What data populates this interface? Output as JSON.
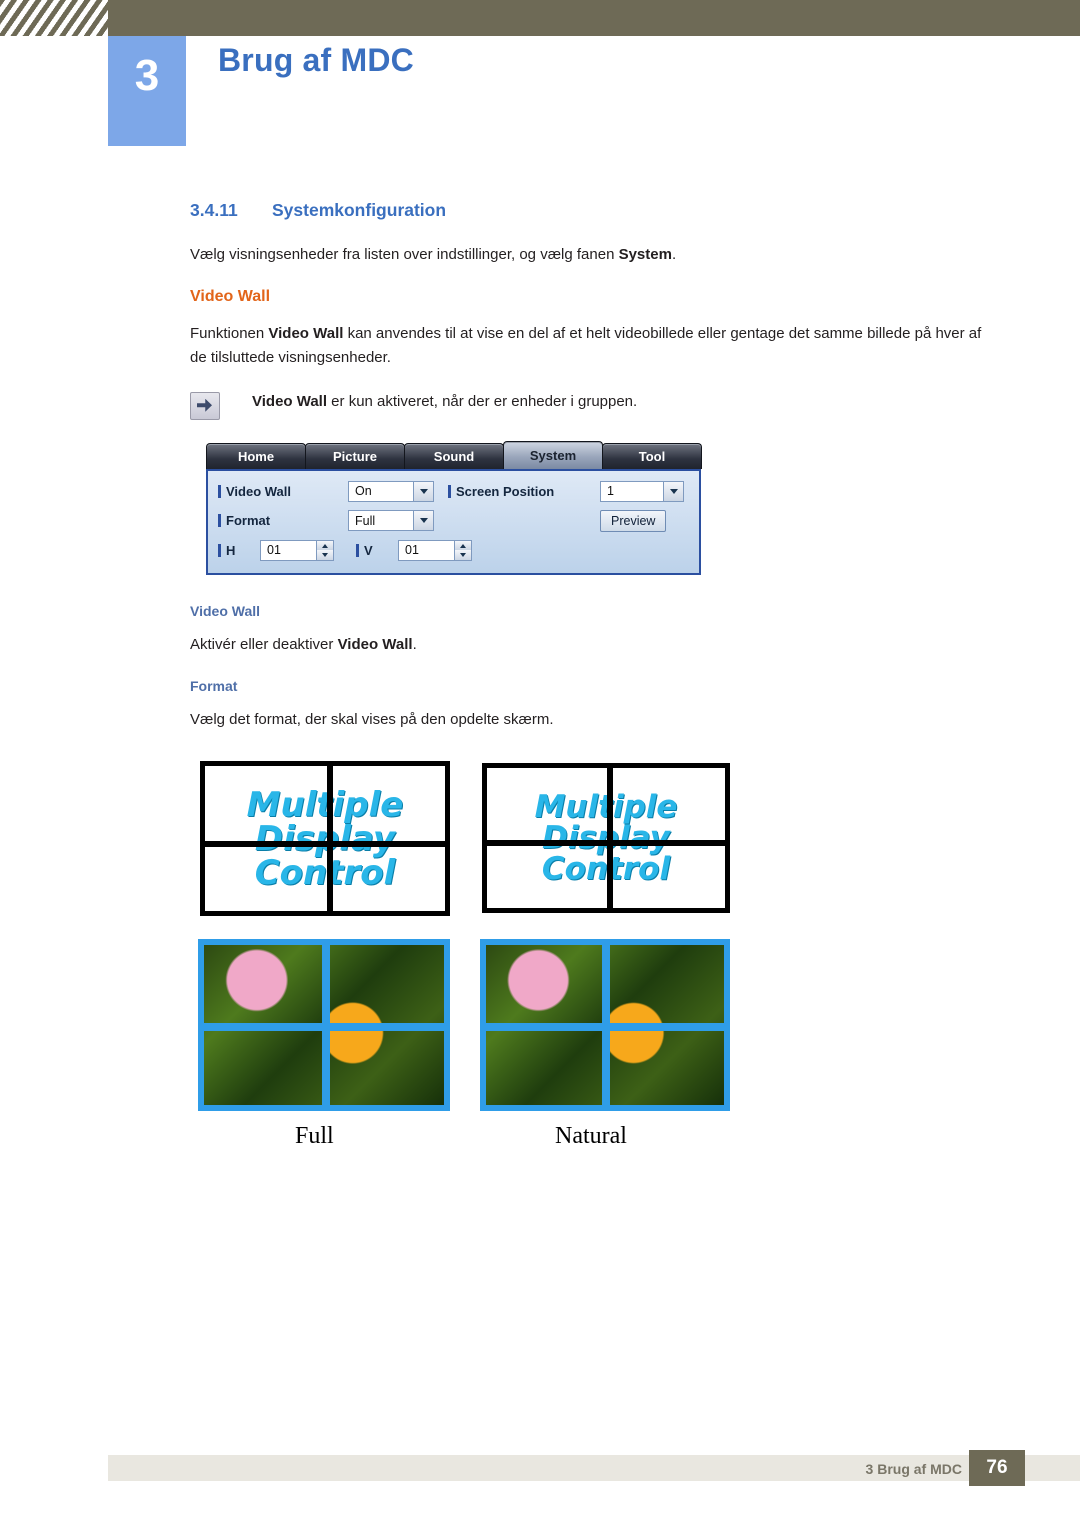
{
  "header": {
    "chapter_number": "3",
    "chapter_title": "Brug af MDC"
  },
  "section": {
    "number": "3.4.11",
    "title": "Systemkonfiguration",
    "intro_prefix": "Vælg visningsenheder fra listen over indstillinger, og vælg fanen ",
    "intro_bold": "System",
    "intro_suffix": "."
  },
  "video_wall": {
    "heading": "Video Wall",
    "para_1_prefix": "Funktionen ",
    "para_1_bold": "Video Wall",
    "para_1_suffix": " kan anvendes til at vise en del af et helt videobillede eller gentage det samme billede på hver af de tilsluttede visningsenheder.",
    "note_bold": "Video Wall",
    "note_rest": " er kun aktiveret, når der er enheder i gruppen.",
    "note_icon": "note-pointer-icon",
    "sub_heading": "Video Wall",
    "sub_text_prefix": "Aktivér eller deaktiver ",
    "sub_text_bold": "Video Wall",
    "sub_text_suffix": "."
  },
  "format": {
    "heading": "Format",
    "text": "Vælg det format, der skal vises på den opdelte skærm.",
    "label_full": "Full",
    "label_natural": "Natural",
    "wall_text_line1": "Multiple",
    "wall_text_line2": "Display",
    "wall_text_line3": "Control"
  },
  "mdc_ui": {
    "tabs": [
      {
        "label": "Home",
        "active": false
      },
      {
        "label": "Picture",
        "active": false
      },
      {
        "label": "Sound",
        "active": false
      },
      {
        "label": "System",
        "active": true
      },
      {
        "label": "Tool",
        "active": false
      }
    ],
    "fields": {
      "video_wall_label": "Video Wall",
      "video_wall_value": "On",
      "screen_position_label": "Screen Position",
      "screen_position_value": "1",
      "format_label": "Format",
      "format_value": "Full",
      "preview_button": "Preview",
      "h_label": "H",
      "h_value": "01",
      "v_label": "V",
      "v_value": "01"
    }
  },
  "footer": {
    "text": "3 Brug af MDC",
    "page": "76"
  },
  "colors": {
    "header_bar": "#6e6a56",
    "chapter_blue": "#7da7e8",
    "title_blue": "#3a6fbf",
    "orange": "#e2651a",
    "subhead_blue": "#4f6fa8",
    "wall_text": "#29b6e8",
    "photo_border": "#2f9de8"
  }
}
